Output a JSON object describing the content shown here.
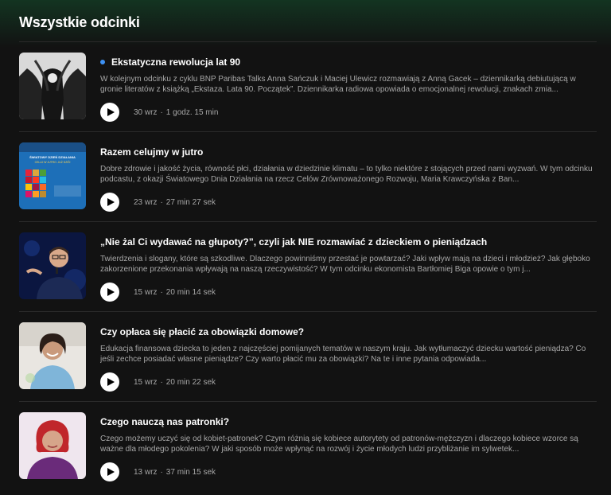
{
  "section": {
    "title": "Wszystkie odcinki"
  },
  "episodes": [
    {
      "title": "Ekstatyczna rewolucja lat 90",
      "is_new": true,
      "description": "W kolejnym odcinku z cyklu BNP Paribas Talks Anna Sańczuk i Maciej Ulewicz rozmawiają z Anną Gacek – dziennikarką debiutującą w gronie literatów z książką „Ekstaza. Lata 90. Początek”. Dziennikarka radiowa opowiada o emocjonalnej rewolucji, znakach zmia...",
      "date": "30 wrz",
      "duration": "1 godz. 15 min"
    },
    {
      "title": "Razem celujmy w jutro",
      "is_new": false,
      "description": "Dobre zdrowie i jakość życia, równość płci, działania w dziedzinie klimatu – to tylko niektóre z stojących przed nami wyzwań. W tym odcinku podcastu, z okazji Światowego Dnia Działania na rzecz Celów Zrównoważonego Rozwoju, Maria Krawczyńska z Ban...",
      "date": "23 wrz",
      "duration": "27 min 27 sek"
    },
    {
      "title": "„Nie żal Ci wydawać na głupoty?”, czyli jak NIE rozmawiać z dzieckiem o pieniądzach",
      "is_new": false,
      "description": "Twierdzenia i slogany, które są szkodliwe. Dlaczego powinniśmy przestać je powtarzać? Jaki wpływ mają na dzieci i młodzież? Jak głęboko zakorzenione przekonania wpływają na naszą rzeczywistość? W tym odcinku ekonomista Bartłomiej Biga opowie o tym j...",
      "date": "15 wrz",
      "duration": "20 min 14 sek"
    },
    {
      "title": "Czy opłaca się płacić za obowiązki domowe?",
      "is_new": false,
      "description": "Edukacja finansowa dziecka to jeden z najczęściej pomijanych tematów w naszym kraju. Jak wytłumaczyć dziecku wartość pieniądza? Co jeśli zechce posiadać własne pieniądze? Czy warto płacić mu za obowiązki? Na te i inne pytania odpowiada...",
      "date": "15 wrz",
      "duration": "20 min 22 sek"
    },
    {
      "title": "Czego nauczą nas patronki?",
      "is_new": false,
      "description": "Czego możemy uczyć się od kobiet-patronek? Czym różnią się kobiece autorytety od patronów-mężczyzn i dlaczego kobiece wzorce są ważne dla młodego pokolenia? W jaki sposób może wpłynąć na rozwój i życie młodych ludzi przybliżanie im sylwetek...",
      "date": "13 wrz",
      "duration": "37 min 15 sek"
    }
  ],
  "meta_separator": "·",
  "thumbnail_art": {
    "sdg_banner_title": "ŚWIATOWY DZIEŃ DZIAŁANIA",
    "sdg_banner_subtitle": "CELUJ W JUTRO. JUŻ DZIŚ!"
  },
  "colors": {
    "background": "#121212",
    "header_gradient": "#133421",
    "new_dot": "#3d91f4",
    "secondary_text": "#a7a7a7",
    "divider": "#2a2a2a"
  },
  "icons": {
    "play": "play-icon"
  }
}
